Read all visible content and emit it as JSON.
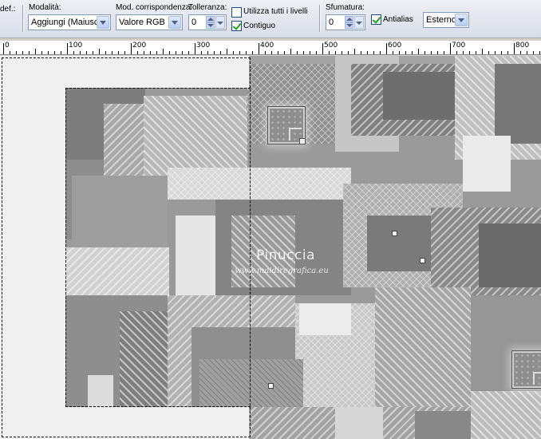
{
  "toolbar": {
    "preset_label": "def.:",
    "mode": {
      "label": "Modalità:",
      "value": "Aggiungi (Maiusc)"
    },
    "match_mode": {
      "label": "Mod. corrispondenza:",
      "value": "Valore RGB"
    },
    "tolerance": {
      "label": "Tolleranza:",
      "value": "0"
    },
    "use_all_layers": {
      "label": "Utilizza tutti i livelli",
      "checked": false
    },
    "contiguous": {
      "label": "Contiguo",
      "checked": true
    },
    "feather": {
      "label": "Sfumatura:",
      "value": "0"
    },
    "antialias": {
      "label": "Antialias",
      "checked": true
    },
    "antialias_mode": {
      "value": "Esterno"
    }
  },
  "ruler": {
    "labels": [
      "0",
      "100",
      "200",
      "300",
      "400",
      "500",
      "600",
      "700",
      "800"
    ]
  },
  "canvas": {
    "watermark_title": "Pinuccia",
    "watermark_url": "www.maidiregrafica.eu"
  },
  "icons": {
    "dropdown": "chevron-down-icon",
    "spin": "spin-arrows-icon",
    "check": "checkmark-icon"
  },
  "colors": {
    "toolbar_bg": "#dfe3ec",
    "canvas_bg": "#f0f0f0",
    "checkmark": "#21a121",
    "combo_border": "#7f9db9"
  }
}
